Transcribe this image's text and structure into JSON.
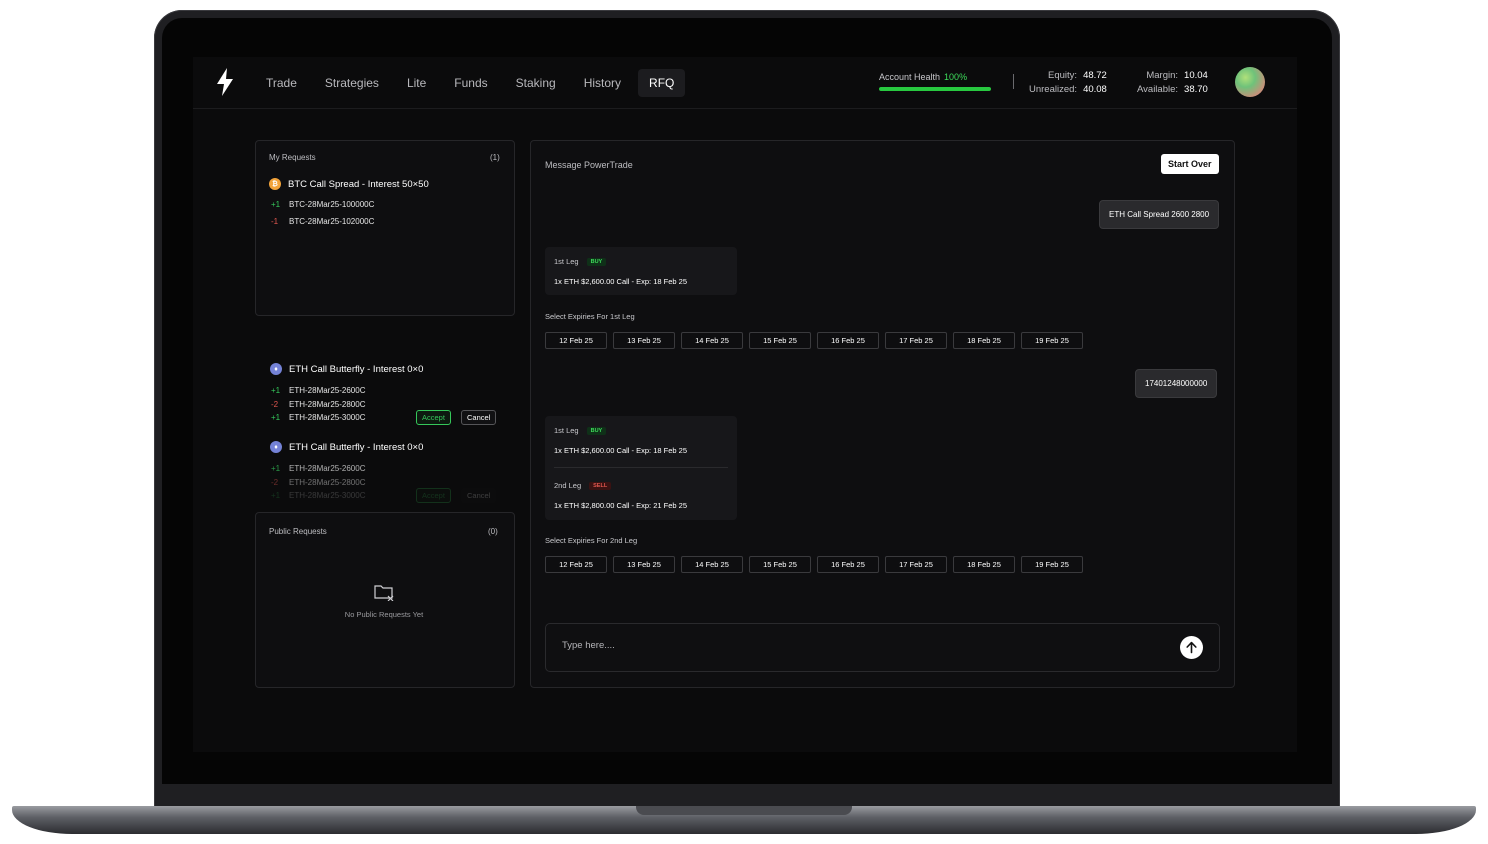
{
  "nav": {
    "items": [
      "Trade",
      "Strategies",
      "Lite",
      "Funds",
      "Staking",
      "History",
      "RFQ"
    ],
    "active": "RFQ"
  },
  "account": {
    "health_label": "Account Health",
    "health_pct": "100%",
    "health_fraction": 1.0,
    "equity_label": "Equity:",
    "equity": "48.72",
    "unrealized_label": "Unrealized:",
    "unrealized": "40.08",
    "margin_label": "Margin:",
    "margin": "10.04",
    "available_label": "Available:",
    "available": "38.70"
  },
  "my_requests": {
    "title": "My Requests",
    "count": "(1)",
    "requests": [
      {
        "coin": "btc-icon",
        "title": "BTC Call Spread - Interest 50×50",
        "legs": [
          {
            "qty": "+1",
            "symbol": "BTC-28Mar25-100000C"
          },
          {
            "qty": "-1",
            "symbol": "BTC-28Mar25-102000C"
          }
        ]
      },
      {
        "coin": "eth-icon",
        "title": "ETH Call Butterfly - Interest 0×0",
        "legs": [
          {
            "qty": "+1",
            "symbol": "ETH-28Mar25-2600C"
          },
          {
            "qty": "-2",
            "symbol": "ETH-28Mar25-2800C"
          },
          {
            "qty": "+1",
            "symbol": "ETH-28Mar25-3000C"
          }
        ],
        "accept": "Accept",
        "cancel": "Cancel"
      },
      {
        "coin": "eth-icon",
        "title": "ETH Call Butterfly - Interest 0×0",
        "legs": [
          {
            "qty": "+1",
            "symbol": "ETH-28Mar25-2600C"
          },
          {
            "qty": "-2",
            "symbol": "ETH-28Mar25-2800C"
          },
          {
            "qty": "+1",
            "symbol": "ETH-28Mar25-3000C"
          }
        ],
        "accept": "Accept",
        "cancel": "Cancel"
      }
    ]
  },
  "public_requests": {
    "title": "Public Requests",
    "count": "(0)",
    "empty_text": "No Public Requests Yet"
  },
  "chat": {
    "title": "Message PowerTrade",
    "start_over": "Start Over",
    "user_msg_1": "ETH Call Spread 2600 2800",
    "user_msg_2": "17401248000000",
    "card1": {
      "leg1_label": "1st Leg",
      "leg1_tag": "BUY",
      "leg1_desc": "1x ETH $2,600.00 Call - Exp: 18 Feb 25"
    },
    "select1_label": "Select Expiries For 1st Leg",
    "card2": {
      "leg1_label": "1st Leg",
      "leg1_tag": "BUY",
      "leg1_desc": "1x ETH $2,600.00 Call - Exp: 18 Feb 25",
      "leg2_label": "2nd Leg",
      "leg2_tag": "SELL",
      "leg2_desc": "1x ETH $2,800.00 Call - Exp: 21 Feb 25"
    },
    "select2_label": "Select Expiries For 2nd Leg",
    "expiries": [
      "12 Feb 25",
      "13 Feb 25",
      "14 Feb 25",
      "15 Feb 25",
      "16 Feb 25",
      "17 Feb 25",
      "18 Feb 25",
      "19 Feb 25"
    ],
    "input_placeholder": "Type here...."
  }
}
